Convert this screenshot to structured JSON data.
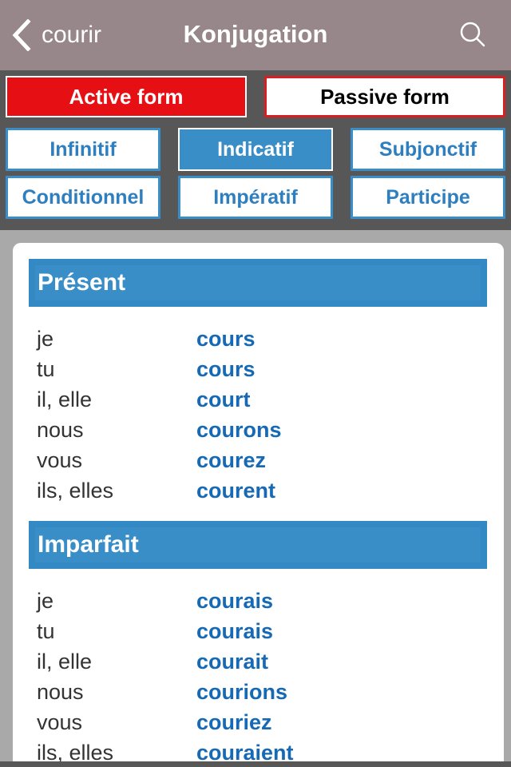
{
  "navbar": {
    "back_label": "courir",
    "title": "Konjugation",
    "back_icon": "chevron-left-icon",
    "search_icon": "search-icon"
  },
  "form_toggle": {
    "active_label": "Active form",
    "passive_label": "Passive form",
    "selected": "active"
  },
  "moods": [
    {
      "label": "Infinitif",
      "selected": false
    },
    {
      "label": "Indicatif",
      "selected": true
    },
    {
      "label": "Subjonctif",
      "selected": false
    },
    {
      "label": "Conditionnel",
      "selected": false
    },
    {
      "label": "Impératif",
      "selected": false
    },
    {
      "label": "Participe",
      "selected": false
    }
  ],
  "tenses": [
    {
      "title": "Présent",
      "rows": [
        {
          "pronoun": "je",
          "form": "cours"
        },
        {
          "pronoun": "tu",
          "form": "cours"
        },
        {
          "pronoun": "il, elle",
          "form": "court"
        },
        {
          "pronoun": "nous",
          "form": "courons"
        },
        {
          "pronoun": "vous",
          "form": "courez"
        },
        {
          "pronoun": "ils, elles",
          "form": "courent"
        }
      ]
    },
    {
      "title": "Imparfait",
      "rows": [
        {
          "pronoun": "je",
          "form": "courais"
        },
        {
          "pronoun": "tu",
          "form": "courais"
        },
        {
          "pronoun": "il, elle",
          "form": "courait"
        },
        {
          "pronoun": "nous",
          "form": "courions"
        },
        {
          "pronoun": "vous",
          "form": "couriez"
        },
        {
          "pronoun": "ils, elles",
          "form": "couraient"
        }
      ]
    }
  ],
  "colors": {
    "navbar": "#97868a",
    "active_red": "#e60f14",
    "accent_blue": "#3a8ec8",
    "verb_blue": "#1569b5"
  }
}
